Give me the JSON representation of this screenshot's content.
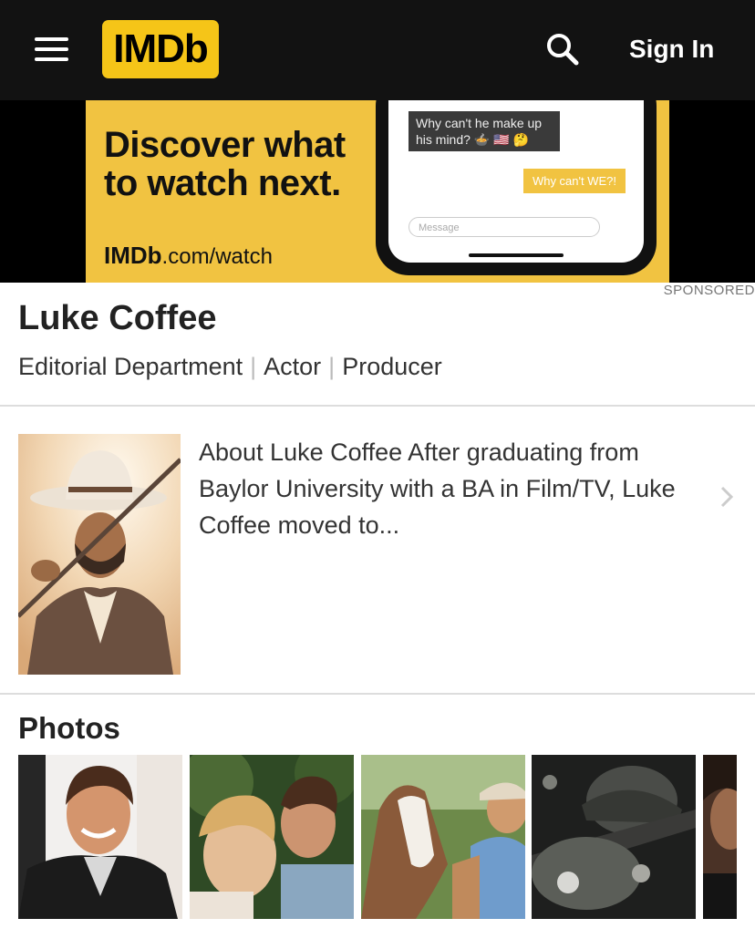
{
  "header": {
    "logo": "IMDb",
    "sign_in": "Sign In"
  },
  "ad": {
    "headline": "Discover what to watch next.",
    "url_brand": "IMDb",
    "url_rest": ".com/watch",
    "bubble_in": "Why can't he make up his mind? 🍲 🇺🇸 🤔",
    "bubble_out": "Why can't WE?!",
    "message_placeholder": "Message",
    "sponsored": "SPONSORED"
  },
  "person": {
    "name": "Luke Coffee",
    "roles": [
      "Editorial Department",
      "Actor",
      "Producer"
    ],
    "separator": "|",
    "bio_preview": "About Luke Coffee After graduating from Baylor University with a BA in Film/TV, Luke Coffee moved to..."
  },
  "photos": {
    "title": "Photos"
  },
  "colors": {
    "header_bg": "#121212",
    "imdb_yellow": "#f5c518",
    "ad_yellow": "#f1c341"
  }
}
